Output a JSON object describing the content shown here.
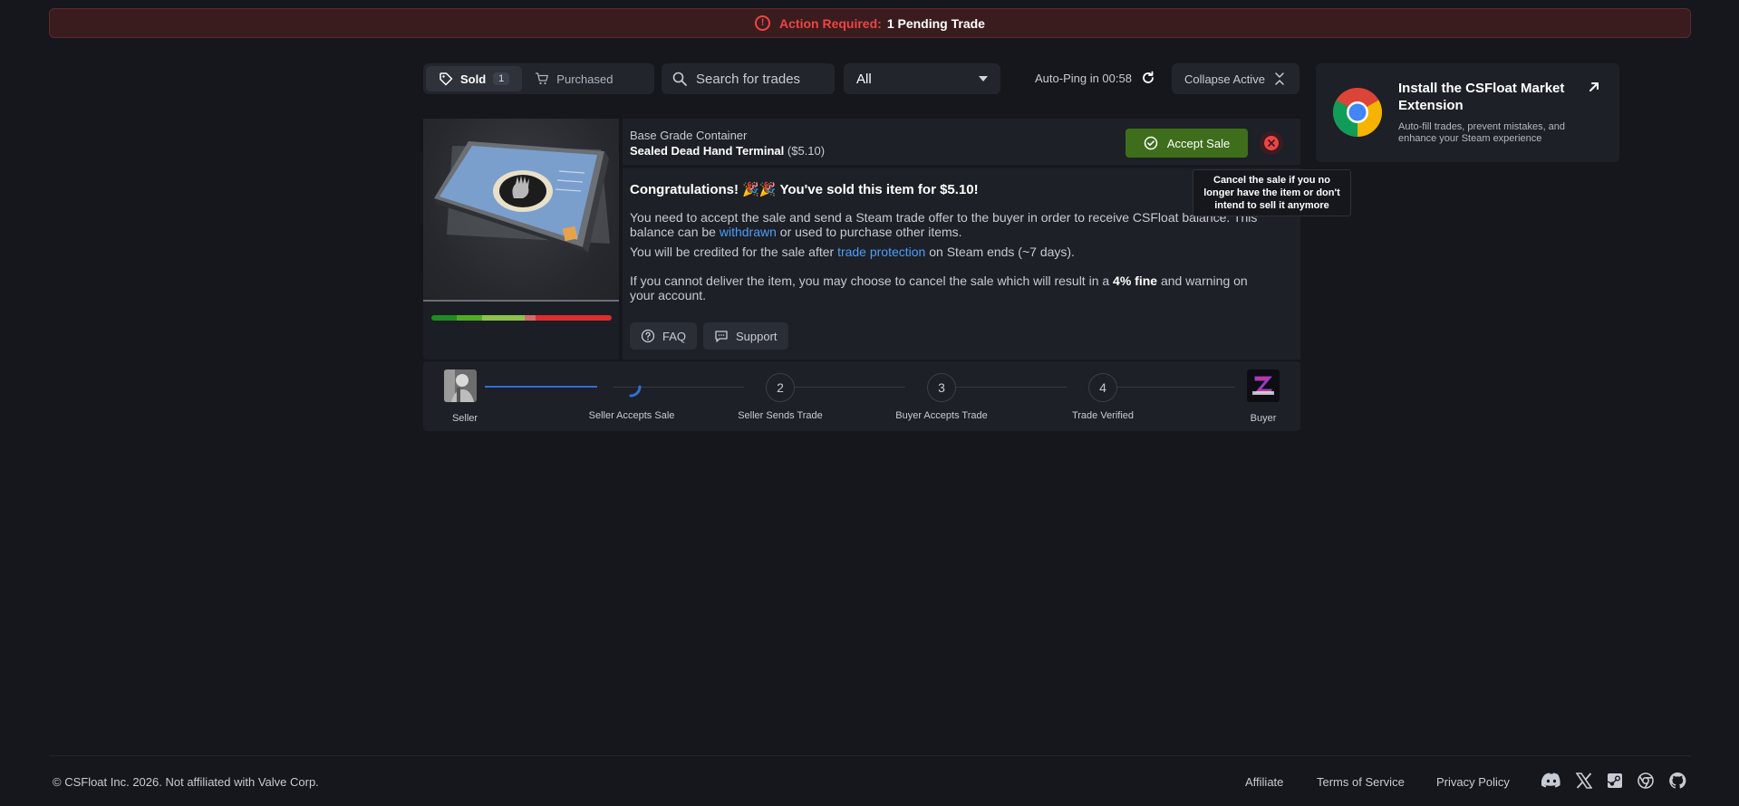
{
  "banner": {
    "label": "Action Required:",
    "message": "1 Pending Trade"
  },
  "tabs": [
    {
      "label": "Sold",
      "badge": "1"
    },
    {
      "label": "Purchased"
    }
  ],
  "search": {
    "placeholder": "Search for trades"
  },
  "filter": {
    "selected": "All"
  },
  "autoping": {
    "text": "Auto-Ping in 00:58"
  },
  "collapse": {
    "label": "Collapse Active"
  },
  "extension": {
    "title": "Install the CSFloat Market Extension",
    "description": "Auto-fill trades, prevent mistakes, and enhance your Steam experience"
  },
  "trade": {
    "category": "Base Grade Container",
    "item_name": "Sealed Dead Hand Terminal",
    "item_price": "($5.10)",
    "accept_label": "Accept Sale",
    "congrats_prefix": "Congratulations!",
    "congrats_emoji": "🎉🎉",
    "congrats_text": "You've sold this item for",
    "congrats_amount": "$5.10",
    "congrats_suffix": "!",
    "para1_a": "You need to accept the sale and send a Steam trade offer to the buyer in order to receive CSFloat balance. This balance can be",
    "para1_link": "withdrawn",
    "para1_b": "or used to purchase other items.",
    "para2_a": "You will be credited for the sale after",
    "para2_link": "trade protection",
    "para2_b": "on Steam ends (~7 days).",
    "para3_a": "If you cannot deliver the item, you may choose to cancel the sale which will result in a",
    "para3_bold": "4% fine",
    "para3_b": "and warning on your account.",
    "faq_label": "FAQ",
    "support_label": "Support",
    "tooltip": "Cancel the sale if you no longer have the item or don't intend to sell it anymore"
  },
  "progress": {
    "seller_label": "Seller",
    "buyer_label": "Buyer",
    "steps": [
      {
        "num": "",
        "label": "Seller Accepts Sale"
      },
      {
        "num": "2",
        "label": "Seller Sends Trade"
      },
      {
        "num": "3",
        "label": "Buyer Accepts Trade"
      },
      {
        "num": "4",
        "label": "Trade Verified"
      }
    ]
  },
  "footer": {
    "copyright": "© CSFloat Inc. 2026. Not affiliated with Valve Corp.",
    "links": [
      "Affiliate",
      "Terms of Service",
      "Privacy Policy"
    ],
    "social_icons": [
      "discord-icon",
      "x-icon",
      "steam-icon",
      "chrome-icon",
      "github-icon"
    ]
  },
  "colors": {
    "background": "#15171c",
    "accent_red": "#ef4444",
    "accept_green": "#3e6e1b",
    "link_blue": "#4a9eff",
    "progress_blue": "#2f6fd8"
  }
}
